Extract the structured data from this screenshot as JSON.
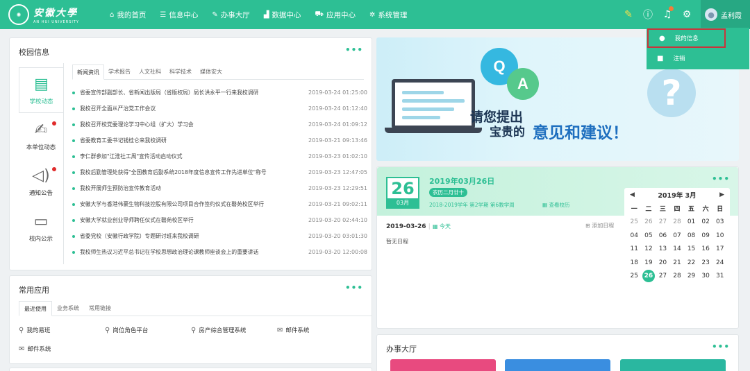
{
  "brand": {
    "name_cn": "安徽大學",
    "name_en": "AN HUI UNIVERSITY"
  },
  "nav": [
    {
      "label": "我的首页",
      "icon": "home-icon"
    },
    {
      "label": "信息中心",
      "icon": "list-icon"
    },
    {
      "label": "办事大厅",
      "icon": "edit-icon"
    },
    {
      "label": "数据中心",
      "icon": "chart-icon"
    },
    {
      "label": "应用中心",
      "icon": "cart-icon"
    },
    {
      "label": "系统管理",
      "icon": "gear-icon"
    }
  ],
  "user": {
    "name": "孟利霞"
  },
  "user_menu": [
    {
      "label": "我的信息",
      "icon": "user-icon"
    },
    {
      "label": "注销",
      "icon": "lock-icon"
    }
  ],
  "campus": {
    "title": "校园信息",
    "side_tabs": [
      "学校动态",
      "本单位动态",
      "通知公告",
      "校内公示"
    ],
    "news_tabs": [
      "新闻资讯",
      "学术报告",
      "人文社科",
      "科学技术",
      "媒体安大"
    ],
    "news": [
      {
        "title": "省委宣传部副部长、省新闻出版局（省版权局）局长洪永平一行来我校调研",
        "date": "2019-03-24 01:25:00"
      },
      {
        "title": "我校召开全面从严治党工作会议",
        "date": "2019-03-24 01:12:40"
      },
      {
        "title": "我校召开校党委理论学习中心组（扩大）学习会",
        "date": "2019-03-24 01:09:12"
      },
      {
        "title": "省委教育工委书记钱桂仑来我校调研",
        "date": "2019-03-21 09:13:46"
      },
      {
        "title": "李仁群参加\"江淮社工周\"宣传活动启动仪式",
        "date": "2019-03-23 01:02:10"
      },
      {
        "title": "我校后勤管理处获得\"全国教育后勤系统2018年度信息宣传工作先进单位\"称号",
        "date": "2019-03-23 12:47:05"
      },
      {
        "title": "我校开展师生预防治宣传教育活动",
        "date": "2019-03-23 12:29:51"
      },
      {
        "title": "安徽大学与香港伟豪生物科技控股有限公司项目合作签约仪式在磬苑校区举行",
        "date": "2019-03-21 09:02:11"
      },
      {
        "title": "安徽大学就业创业导师聘任仪式在磬苑校区举行",
        "date": "2019-03-20 02:44:10"
      },
      {
        "title": "省委党校（安徽行政学院）专题研讨班来我校调研",
        "date": "2019-03-20 03:01:30"
      },
      {
        "title": "我校师生热议习近平总书记在学校思想政治理论课教师座谈会上的重要讲话",
        "date": "2019-03-20 12:00:08"
      }
    ]
  },
  "apps": {
    "title": "常用应用",
    "tabs": [
      "最近使用",
      "业务系统",
      "常用链接"
    ],
    "items": [
      "我的易班",
      "岗位角色平台",
      "房产综合管理系统",
      "邮件系统",
      "邮件系统"
    ]
  },
  "banner": {
    "q": "Q",
    "a": "A",
    "line1": "请您提出",
    "line2": "宝贵的",
    "line3": "意见和建议！"
  },
  "calendar": {
    "day": "26",
    "month": "03月",
    "full_date": "2019年03月26日",
    "lunar": "农历二月廿十",
    "term": "2018-2019学年 第2学期 第6教学周",
    "calendar_link": "查看校历",
    "schedule_date": "2019-03-26",
    "today_label": "今天",
    "add_label": "添加日程",
    "empty_label": "暂无日程",
    "mini_title": "2019年 3月",
    "weekdays": [
      "一",
      "二",
      "三",
      "四",
      "五",
      "六",
      "日"
    ],
    "days": [
      [
        "25",
        "26",
        "27",
        "28",
        "01",
        "02",
        "03"
      ],
      [
        "04",
        "05",
        "06",
        "07",
        "08",
        "09",
        "10"
      ],
      [
        "11",
        "12",
        "13",
        "14",
        "15",
        "16",
        "17"
      ],
      [
        "18",
        "19",
        "20",
        "21",
        "22",
        "23",
        "24"
      ],
      [
        "25",
        "26",
        "27",
        "28",
        "29",
        "30",
        "31"
      ]
    ]
  },
  "office": {
    "title": "办事大厅"
  },
  "colors": {
    "brand": "#2dbf94",
    "tile1": "#e84a7f",
    "tile2": "#3a8ee0",
    "tile3": "#2ab7a0"
  }
}
